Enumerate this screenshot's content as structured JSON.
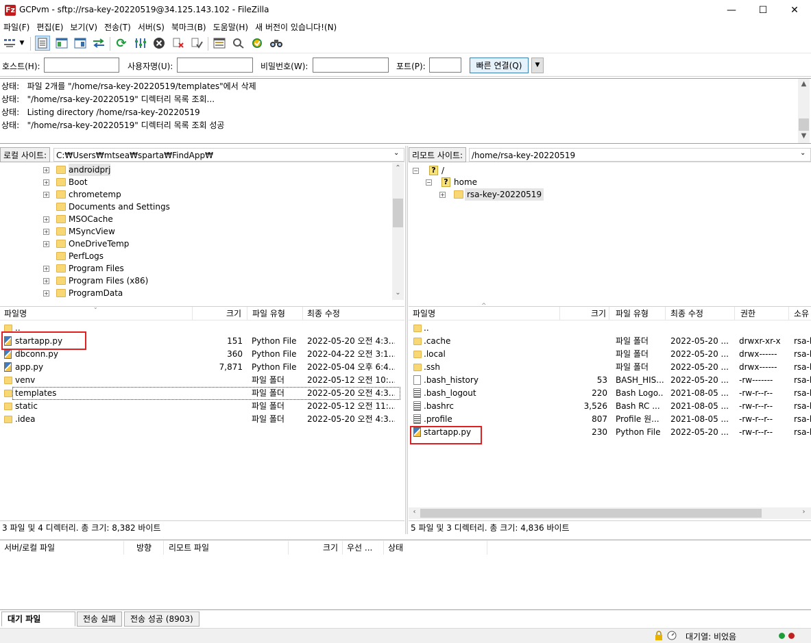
{
  "window": {
    "title": "GCPvm - sftp://rsa-key-20220519@34.125.143.102 - FileZilla",
    "app_icon": "Fz",
    "minimize": "—",
    "maximize": "☐",
    "close": "✕"
  },
  "menu": [
    "파일(F)",
    "편집(E)",
    "보기(V)",
    "전송(T)",
    "서버(S)",
    "북마크(B)",
    "도움말(H)",
    "새 버전이 있습니다!(N)"
  ],
  "quickconnect": {
    "host_label": "호스트(H):",
    "user_label": "사용자명(U):",
    "pass_label": "비밀번호(W):",
    "port_label": "포트(P):",
    "host_value": "",
    "user_value": "",
    "pass_value": "",
    "port_value": "",
    "connect_button": "빠른 연결(Q)",
    "dropdown": "▼"
  },
  "log": [
    {
      "label": "상태:",
      "text": "파일 2개를 \"/home/rsa-key-20220519/templates\"에서 삭제"
    },
    {
      "label": "상태:",
      "text": "\"/home/rsa-key-20220519\" 디렉터리 목록 조회..."
    },
    {
      "label": "상태:",
      "text": "Listing directory /home/rsa-key-20220519"
    },
    {
      "label": "상태:",
      "text": "\"/home/rsa-key-20220519\" 디렉터리 목록 조회 성공"
    }
  ],
  "local": {
    "site_label": "로컬 사이트:",
    "path": "C:₩Users₩mtsea₩sparta₩FindApp₩",
    "tree": [
      "androidprj",
      "Boot",
      "chrometemp",
      "Documents and Settings",
      "MSOCache",
      "MSyncView",
      "OneDriveTemp",
      "PerfLogs",
      "Program Files",
      "Program Files (x86)",
      "ProgramData"
    ],
    "tree_expandable": [
      true,
      true,
      true,
      false,
      true,
      true,
      true,
      false,
      true,
      true,
      true
    ],
    "columns": [
      "파일명",
      "크기",
      "파일 유형",
      "최종 수정"
    ],
    "files": [
      {
        "name": "..",
        "size": "",
        "type": "",
        "modified": "",
        "icon": "folder-icon"
      },
      {
        "name": "startapp.py",
        "size": "151",
        "type": "Python File",
        "modified": "2022-05-20 오전 4:3...",
        "icon": "python-file-icon"
      },
      {
        "name": "dbconn.py",
        "size": "360",
        "type": "Python File",
        "modified": "2022-04-22 오전 3:1...",
        "icon": "python-file-icon"
      },
      {
        "name": "app.py",
        "size": "7,871",
        "type": "Python File",
        "modified": "2022-05-04 오후 6:4...",
        "icon": "python-file-icon"
      },
      {
        "name": "venv",
        "size": "",
        "type": "파일 폴더",
        "modified": "2022-05-12 오전 10:...",
        "icon": "folder-icon"
      },
      {
        "name": "templates",
        "size": "",
        "type": "파일 폴더",
        "modified": "2022-05-20 오전 4:3...",
        "icon": "folder-icon"
      },
      {
        "name": "static",
        "size": "",
        "type": "파일 폴더",
        "modified": "2022-05-12 오전 11:...",
        "icon": "folder-icon"
      },
      {
        "name": ".idea",
        "size": "",
        "type": "파일 폴더",
        "modified": "2022-05-20 오전 4:3...",
        "icon": "folder-icon"
      }
    ],
    "status": "3 파일 및 4 디렉터리. 총 크기: 8,382 바이트"
  },
  "remote": {
    "site_label": "리모트 사이트:",
    "path": "/home/rsa-key-20220519",
    "tree": [
      "/",
      "home",
      "rsa-key-20220519"
    ],
    "columns": [
      "파일명",
      "크기",
      "파일 유형",
      "최종 수정",
      "권한",
      "소유"
    ],
    "files": [
      {
        "name": "..",
        "size": "",
        "type": "",
        "modified": "",
        "perm": "",
        "owner": "",
        "icon": "folder-icon"
      },
      {
        "name": ".cache",
        "size": "",
        "type": "파일 폴더",
        "modified": "2022-05-20 ...",
        "perm": "drwxr-xr-x",
        "owner": "rsa-k",
        "icon": "folder-icon"
      },
      {
        "name": ".local",
        "size": "",
        "type": "파일 폴더",
        "modified": "2022-05-20 ...",
        "perm": "drwx------",
        "owner": "rsa-k",
        "icon": "folder-icon"
      },
      {
        "name": ".ssh",
        "size": "",
        "type": "파일 폴더",
        "modified": "2022-05-20 ...",
        "perm": "drwx------",
        "owner": "rsa-k",
        "icon": "folder-icon"
      },
      {
        "name": ".bash_history",
        "size": "53",
        "type": "BASH_HIS...",
        "modified": "2022-05-20 ...",
        "perm": "-rw-------",
        "owner": "rsa-k",
        "icon": "file-icon"
      },
      {
        "name": ".bash_logout",
        "size": "220",
        "type": "Bash Logo...",
        "modified": "2021-08-05 ...",
        "perm": "-rw-r--r--",
        "owner": "rsa-k",
        "icon": "text-file-icon"
      },
      {
        "name": ".bashrc",
        "size": "3,526",
        "type": "Bash RC ...",
        "modified": "2021-08-05 ...",
        "perm": "-rw-r--r--",
        "owner": "rsa-k",
        "icon": "text-file-icon"
      },
      {
        "name": ".profile",
        "size": "807",
        "type": "Profile 원...",
        "modified": "2021-08-05 ...",
        "perm": "-rw-r--r--",
        "owner": "rsa-k",
        "icon": "text-file-icon"
      },
      {
        "name": "startapp.py",
        "size": "230",
        "type": "Python File",
        "modified": "2022-05-20 ...",
        "perm": "-rw-r--r--",
        "owner": "rsa-k",
        "icon": "python-file-icon"
      }
    ],
    "status": "5 파일 및 3 디렉터리. 총 크기: 4,836 바이트"
  },
  "queue": {
    "columns": [
      "서버/로컬 파일",
      "방향",
      "리모트 파일",
      "크기",
      "우선 ...",
      "상태"
    ],
    "tabs": [
      "대기 파일",
      "전송 실패",
      "전송 성공 (8903)"
    ]
  },
  "statusbar": {
    "queue_text": "대기열: 비었음"
  },
  "colors": {
    "highlight_box": "#e02020",
    "folder": "#f8d775",
    "quickconnect_border": "#3c7fb1"
  }
}
